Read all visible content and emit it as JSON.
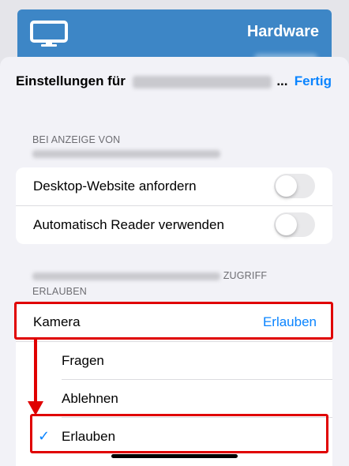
{
  "background": {
    "title": "Hardware",
    "monitor_icon": "desktop-monitor-icon"
  },
  "sheet": {
    "title_prefix": "Einstellungen für",
    "title_suffix": "...",
    "done_label": "Fertig"
  },
  "display_section": {
    "header": "BEI ANZEIGE VON",
    "rows": [
      {
        "label": "Desktop-Website anfordern",
        "enabled": false
      },
      {
        "label": "Automatisch Reader verwenden",
        "enabled": false
      }
    ]
  },
  "access_section": {
    "header_suffix": "ZUGRIFF",
    "header_line2": "ERLAUBEN",
    "camera": {
      "label": "Kamera",
      "value": "Erlauben"
    },
    "options": [
      {
        "label": "Fragen",
        "selected": false
      },
      {
        "label": "Ablehnen",
        "selected": false
      },
      {
        "label": "Erlauben",
        "selected": true
      }
    ],
    "checkmark": "✓"
  },
  "colors": {
    "accent": "#0a84ff",
    "annotation": "#e00000",
    "bg_card": "#3d86c6"
  }
}
